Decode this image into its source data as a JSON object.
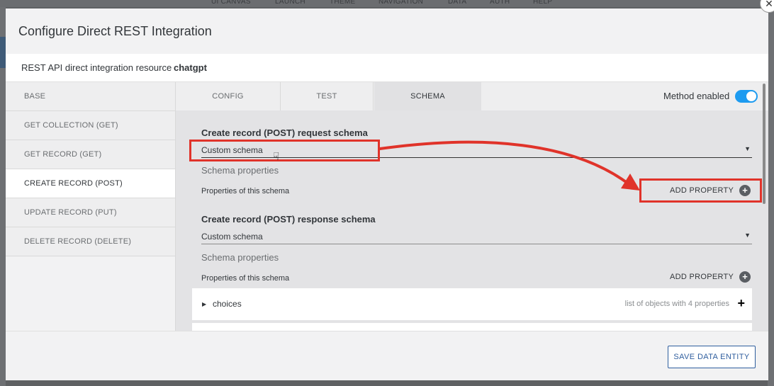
{
  "background_nav": [
    "UI CANVAS",
    "LAUNCH",
    "THEME",
    "NAVIGATION",
    "DATA",
    "AUTH",
    "HELP"
  ],
  "dialog": {
    "title": "Configure Direct REST Integration",
    "resource_label": "REST API direct integration resource",
    "resource_value": "chatgpt",
    "close_icon": "close-icon"
  },
  "sidebar": {
    "items": [
      {
        "label": "BASE"
      },
      {
        "label": "GET COLLECTION (GET)"
      },
      {
        "label": "GET RECORD (GET)"
      },
      {
        "label": "CREATE RECORD (POST)",
        "active": true
      },
      {
        "label": "UPDATE RECORD (PUT)"
      },
      {
        "label": "DELETE RECORD (DELETE)"
      }
    ]
  },
  "tabs": [
    {
      "label": "CONFIG"
    },
    {
      "label": "TEST"
    },
    {
      "label": "SCHEMA",
      "active": true
    }
  ],
  "method_enabled": {
    "label": "Method enabled",
    "value": true,
    "accent": "#1d9bf0"
  },
  "request_schema": {
    "title": "Create record (POST) request schema",
    "select_value": "Custom schema",
    "schema_properties": "Schema properties",
    "properties_label": "Properties of this schema",
    "add_property": "ADD PROPERTY"
  },
  "response_schema": {
    "title": "Create record (POST) response schema",
    "select_value": "Custom schema",
    "schema_properties": "Schema properties",
    "properties_label": "Properties of this schema",
    "add_property": "ADD PROPERTY",
    "properties": [
      {
        "name": "choices",
        "description": "list of objects with 4 properties"
      }
    ]
  },
  "footer": {
    "save_label": "SAVE DATA ENTITY"
  },
  "annotation_color": "#e0332a"
}
